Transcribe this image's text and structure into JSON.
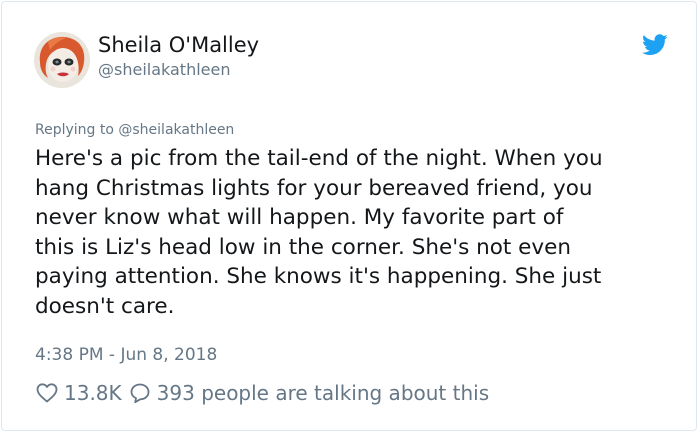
{
  "author": {
    "display_name": "Sheila O'Malley",
    "handle": "@sheilakathleen",
    "avatar_icon": "profile-photo"
  },
  "brand": {
    "icon": "twitter-bird-icon",
    "color": "#1da1f2"
  },
  "reply_context": "Replying to @sheilakathleen",
  "tweet": {
    "lines": [
      "Here's a pic from the tail-end of the night. When you",
      "hang Christmas lights for your bereaved friend, you",
      "never know what will happen. My favorite part of",
      "this is Liz's head low in the corner. She's not even",
      "paying attention. She knows it's happening. She just",
      "doesn't care."
    ],
    "timestamp": "4:38 PM - Jun 8, 2018"
  },
  "engagement": {
    "like_icon": "heart-icon",
    "likes": "13.8K",
    "reply_icon": "speech-bubble-icon",
    "talking": "393 people are talking about this"
  },
  "colors": {
    "text": "#14171a",
    "secondary": "#657786",
    "border": "#e1e8ed"
  }
}
